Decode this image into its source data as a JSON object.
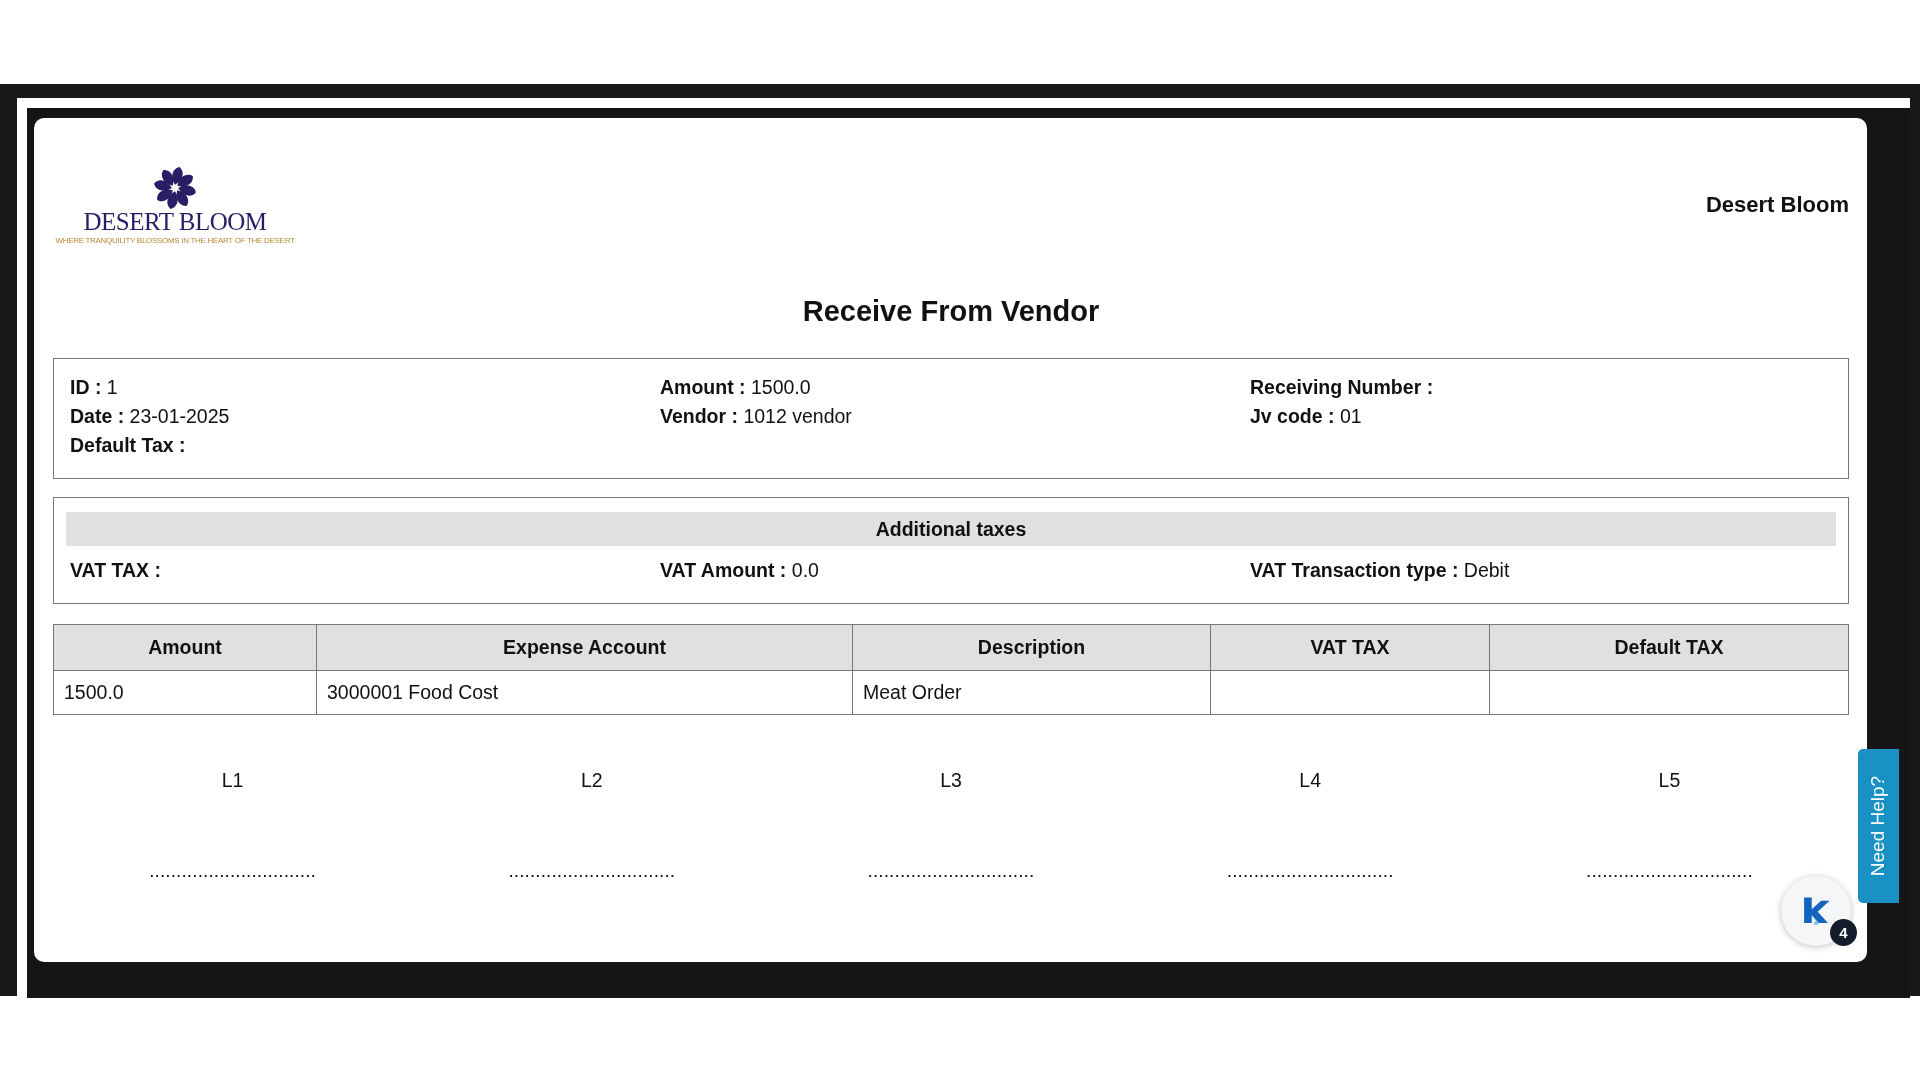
{
  "logo": {
    "name": "DESERT BLOOM",
    "tagline": "WHERE TRANQUILITY BLOSSOMS IN THE HEART OF THE DESERT"
  },
  "company": "Desert Bloom",
  "title": "Receive From Vendor",
  "info": [
    [
      {
        "label": "ID :",
        "value": "1"
      },
      {
        "label": "Date :",
        "value": "23-01-2025"
      },
      {
        "label": "Default Tax :"
      }
    ],
    [
      {
        "label": "Amount :",
        "value": "1500.0"
      },
      {
        "label": "Vendor :",
        "value": "1012 vendor"
      }
    ],
    [
      {
        "label": "Receiving Number :"
      },
      {
        "label": "Jv code :",
        "value": "01"
      }
    ]
  ],
  "additional_taxes": {
    "heading": "Additional taxes",
    "fields": [
      {
        "label": "VAT TAX :"
      },
      {
        "label": "VAT Amount :",
        "value": "0.0"
      },
      {
        "label": "VAT Transaction type :",
        "value": "Debit"
      }
    ]
  },
  "table": {
    "columns": [
      "Amount",
      "Expense Account",
      "Description",
      "VAT TAX",
      "Default TAX"
    ],
    "rows": [
      [
        "1500.0",
        "3000001 Food Cost",
        "Meat Order",
        "",
        ""
      ]
    ]
  },
  "signatures": [
    {
      "label": "L1",
      "line": "..............................."
    },
    {
      "label": "L2",
      "line": "..............................."
    },
    {
      "label": "L3",
      "line": "..............................."
    },
    {
      "label": "L4",
      "line": "..............................."
    },
    {
      "label": "L5",
      "line": "..............................."
    }
  ],
  "help_tab": "Need Help?",
  "chat_badge": "4"
}
